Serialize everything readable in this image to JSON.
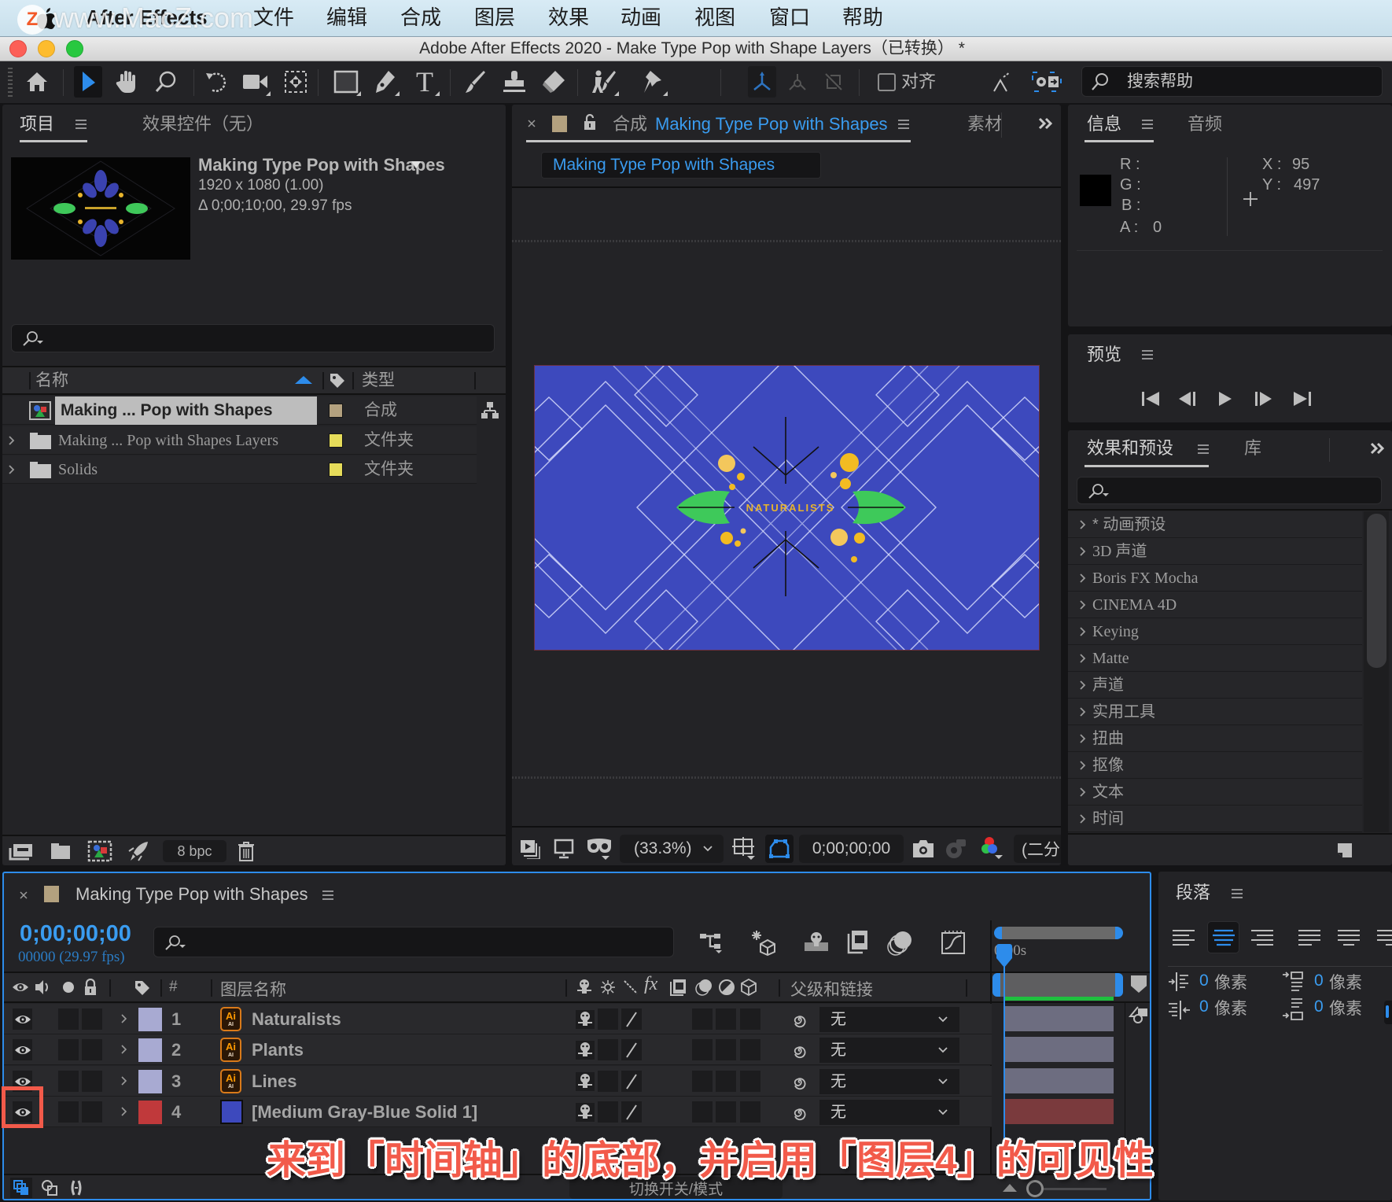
{
  "watermark": "www.MacZ.com",
  "menubar": {
    "app_name": "After Effects",
    "items": [
      "文件",
      "编辑",
      "合成",
      "图层",
      "效果",
      "动画",
      "视图",
      "窗口",
      "帮助"
    ]
  },
  "window": {
    "title": "Adobe After Effects 2020 - Make Type Pop with Shape Layers（已转换） *"
  },
  "toolbar": {
    "active_tool": "selection",
    "tools": [
      "home",
      "selection",
      "hand",
      "zoom",
      "rotation",
      "camera",
      "pan-behind",
      "rectangle",
      "pen",
      "type",
      "brush",
      "clone-stamp",
      "eraser",
      "roto-brush",
      "puppet-pin"
    ],
    "snap_label": "对齐",
    "search_placeholder": "搜索帮助"
  },
  "project": {
    "tabs": [
      {
        "label": "项目",
        "active": true
      },
      {
        "label": "效果控件（无）",
        "active": false
      }
    ],
    "preview": {
      "name": "Making Type Pop with Shapes",
      "resolution": "1920 x 1080 (1.00)",
      "duration": "Δ 0;00;10;00, 29.97 fps"
    },
    "search_value": "",
    "columns": {
      "name": "名称",
      "type": "类型"
    },
    "items": [
      {
        "name": "Making ... Pop with Shapes",
        "type": "合成",
        "kind": "composition",
        "label_color": "#b3a17f",
        "selected": true
      },
      {
        "name": "Making ... Pop with Shapes Layers",
        "type": "文件夹",
        "kind": "folder",
        "label_color": "#e6dc5a",
        "selected": false
      },
      {
        "name": "Solids",
        "type": "文件夹",
        "kind": "folder",
        "label_color": "#e6dc5a",
        "selected": false
      }
    ],
    "bit_depth": "8 bpc"
  },
  "composition": {
    "tab_prefix": "合成",
    "tab_name": "Making Type Pop with Shapes",
    "tab_color": "#b3a17f",
    "second_tab": "素材",
    "breadcrumb": "Making Type Pop with Shapes",
    "canvas_text": "NATURALISTS",
    "canvas_bg": "#3d49bd",
    "zoom": "(33.3%)",
    "timecode": "0;00;00;00",
    "resolution": "(二分"
  },
  "info": {
    "tabs": [
      {
        "label": "信息",
        "active": true
      },
      {
        "label": "音频",
        "active": false
      }
    ],
    "swatch": "#000000",
    "r_label": "R :",
    "r_value": "",
    "g_label": "G :",
    "g_value": "",
    "b_label": "B :",
    "b_value": "",
    "a_label": "A :",
    "a_value": "0",
    "x_label": "X :",
    "x_value": "95",
    "y_label": "Y :",
    "y_value": "497"
  },
  "preview": {
    "title": "预览"
  },
  "effects": {
    "tabs": [
      {
        "label": "效果和预设",
        "active": true
      },
      {
        "label": "库",
        "active": false
      }
    ],
    "search_value": "",
    "items": [
      "* 动画预设",
      "3D 声道",
      "Boris FX Mocha",
      "CINEMA 4D",
      "Keying",
      "Matte",
      "声道",
      "实用工具",
      "扭曲",
      "抠像",
      "文本",
      "时间"
    ]
  },
  "timeline": {
    "comp_name": "Making Type Pop with Shapes",
    "comp_color": "#b3a17f",
    "timecode": "0;00;00;00",
    "frame_info": "00000 (29.97 fps)",
    "search_value": "",
    "ruler_label": "0:00s",
    "columns": {
      "num": "#",
      "layer_name": "图层名称",
      "parent": "父级和链接"
    },
    "layers": [
      {
        "num": "1",
        "name": "Naturalists",
        "type": "illustrator",
        "label_color": "#a8aad2",
        "bar_color": "#6d6d80",
        "visible": true,
        "parent": "无"
      },
      {
        "num": "2",
        "name": "Plants",
        "type": "illustrator",
        "label_color": "#a8aad2",
        "bar_color": "#6d6d80",
        "visible": true,
        "parent": "无"
      },
      {
        "num": "3",
        "name": "Lines",
        "type": "illustrator",
        "label_color": "#a8aad2",
        "bar_color": "#6d6d80",
        "visible": true,
        "parent": "无"
      },
      {
        "num": "4",
        "name": "[Medium Gray-Blue Solid 1]",
        "type": "solid",
        "solid_color": "#3d49bd",
        "label_color": "#c0393b",
        "bar_color": "#7a3a3d",
        "visible": true,
        "parent": "无",
        "highlighted": true
      }
    ],
    "toggle_label": "切换开关/模式"
  },
  "paragraph": {
    "title": "段落",
    "active_alignment": "center",
    "indents": [
      {
        "value": "0",
        "unit": "像素"
      },
      {
        "value": "0",
        "unit": "像素"
      },
      {
        "value": "0",
        "unit": "像素"
      },
      {
        "value": "0",
        "unit": "像素"
      }
    ]
  },
  "caption": "来到「时间轴」的底部，并启用「图层4」的可见性",
  "colors": {
    "accent": "#3a9cf0",
    "caption": "#f25a4a",
    "highlight_box": "#f25a4a"
  }
}
